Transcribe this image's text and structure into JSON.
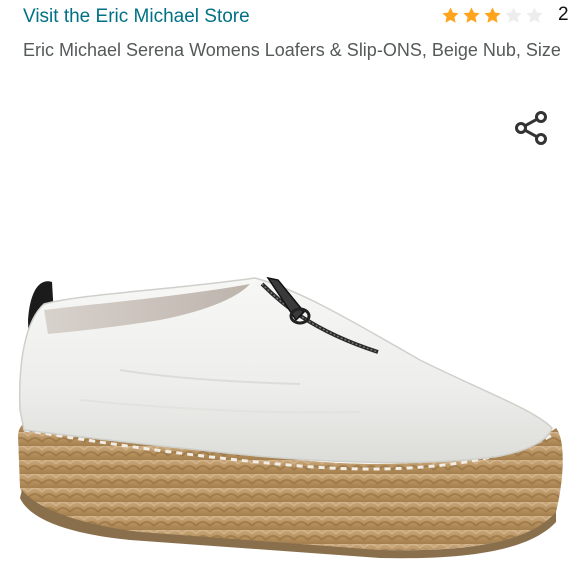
{
  "store": {
    "link_text": "Visit the Eric Michael Store"
  },
  "rating": {
    "stars": 3,
    "max_stars": 5,
    "count": "2",
    "filled_color": "#FFA41C",
    "empty_color": "#EDEDED"
  },
  "product": {
    "title": "Eric Michael Serena Womens Loafers & Slip-ONS, Beige Nub, Size",
    "image_alt": "white leather zip-front espadrille loafer"
  },
  "actions": {
    "share_icon": "share-icon"
  },
  "colors": {
    "link": "#007185",
    "title_text": "#565959"
  }
}
